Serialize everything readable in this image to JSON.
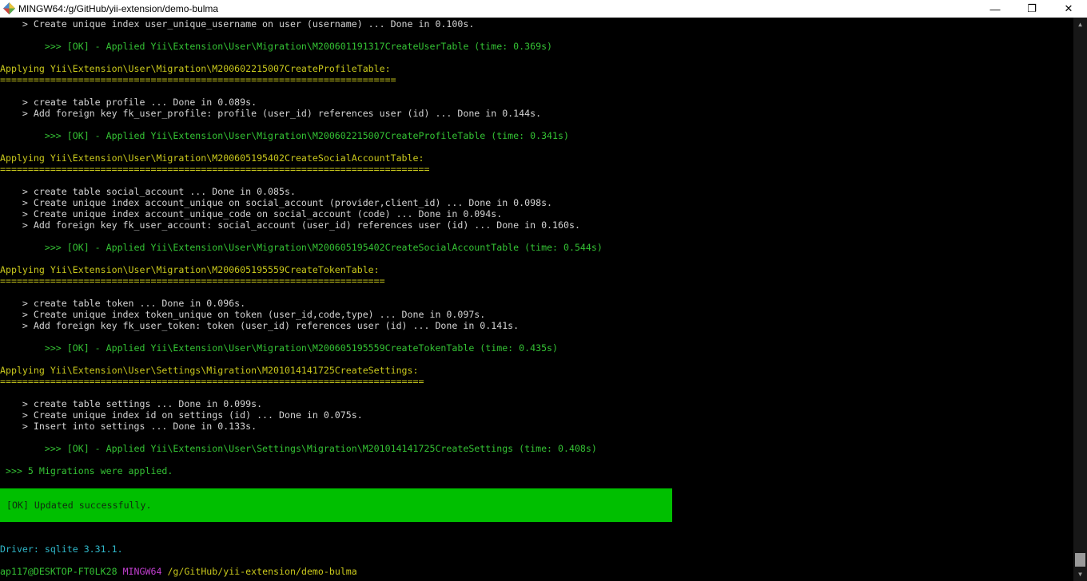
{
  "window": {
    "title": "MINGW64:/g/GitHub/yii-extension/demo-bulma",
    "controls": {
      "minimize": "—",
      "maximize": "❐",
      "close": "✕"
    },
    "icon": "mingw-terminal-icon"
  },
  "colors": {
    "background": "#000000",
    "text": "#d4d4d4",
    "success": "#34c234",
    "heading": "#c9c81c",
    "info": "#2fb7c9",
    "prompt_host": "#c23fd0",
    "banner_bg": "#00bf00"
  },
  "terminal": {
    "lines": [
      "    > Create unique index user_unique_username on user (username) ... Done in 0.100s.",
      "",
      "        >>> [OK] - Applied Yii\\Extension\\User\\Migration\\M200601191317CreateUserTable (time: 0.369s)",
      "",
      "Applying Yii\\Extension\\User\\Migration\\M200602215007CreateProfileTable:",
      "=======================================================================",
      "",
      "",
      "    > create table profile ... Done in 0.089s.",
      "    > Add foreign key fk_user_profile: profile (user_id) references user (id) ... Done in 0.144s.",
      "",
      "        >>> [OK] - Applied Yii\\Extension\\User\\Migration\\M200602215007CreateProfileTable (time: 0.341s)",
      "",
      "Applying Yii\\Extension\\User\\Migration\\M200605195402CreateSocialAccountTable:",
      "=============================================================================",
      "",
      "",
      "    > create table social_account ... Done in 0.085s.",
      "    > Create unique index account_unique on social_account (provider,client_id) ... Done in 0.098s.",
      "    > Create unique index account_unique_code on social_account (code) ... Done in 0.094s.",
      "    > Add foreign key fk_user_account: social_account (user_id) references user (id) ... Done in 0.160s.",
      "",
      "        >>> [OK] - Applied Yii\\Extension\\User\\Migration\\M200605195402CreateSocialAccountTable (time: 0.544s)",
      "",
      "Applying Yii\\Extension\\User\\Migration\\M200605195559CreateTokenTable:",
      "=====================================================================",
      "",
      "",
      "    > create table token ... Done in 0.096s.",
      "    > Create unique index token_unique on token (user_id,code,type) ... Done in 0.097s.",
      "    > Add foreign key fk_user_token: token (user_id) references user (id) ... Done in 0.141s.",
      "",
      "        >>> [OK] - Applied Yii\\Extension\\User\\Migration\\M200605195559CreateTokenTable (time: 0.435s)",
      "",
      "Applying Yii\\Extension\\User\\Settings\\Migration\\M201014141725CreateSettings:",
      "============================================================================",
      "",
      "    > create table settings ... Done in 0.099s.",
      "    > Create unique index id on settings (id) ... Done in 0.075s.",
      "    > Insert into settings ... Done in 0.133s.",
      "",
      "        >>> [OK] - Applied Yii\\Extension\\User\\Settings\\Migration\\M201014141725CreateSettings (time: 0.408s)",
      "",
      " >>> 5 Migrations were applied."
    ],
    "banner": "[OK] Updated successfully.",
    "driver": "Driver: sqlite 3.31.1.",
    "prompt": {
      "user_host": "ap117@DESKTOP-FT0LK28",
      "shell": "MINGW64",
      "path": "/g/GitHub/yii-extension/demo-bulma"
    }
  }
}
